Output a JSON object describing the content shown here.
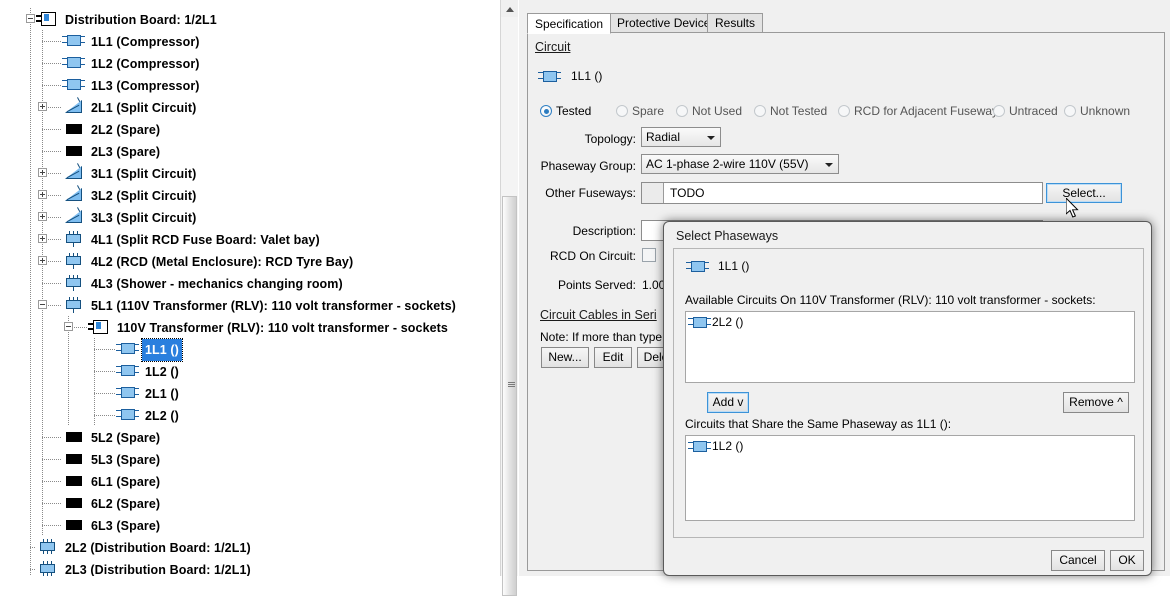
{
  "tree": {
    "name": "circuit-tree",
    "rows": [
      {
        "label": "Distribution Board: 1/2L1",
        "icon": "board-icon",
        "depth": 0,
        "expander": "minus",
        "selected": false
      },
      {
        "label": "1L1 (Compressor)",
        "icon": "circuit-icon",
        "depth": 1,
        "expander": "none",
        "selected": false
      },
      {
        "label": "1L2 (Compressor)",
        "icon": "circuit-icon",
        "depth": 1,
        "expander": "none",
        "selected": false
      },
      {
        "label": "1L3 (Compressor)",
        "icon": "circuit-icon",
        "depth": 1,
        "expander": "none",
        "selected": false
      },
      {
        "label": "2L1 (Split Circuit)",
        "icon": "split-circuit-icon",
        "depth": 1,
        "expander": "plus",
        "selected": false
      },
      {
        "label": "2L2 (Spare)",
        "icon": "spare-icon",
        "depth": 1,
        "expander": "none",
        "selected": false
      },
      {
        "label": "2L3 (Spare)",
        "icon": "spare-icon",
        "depth": 1,
        "expander": "none",
        "selected": false
      },
      {
        "label": "3L1 (Split Circuit)",
        "icon": "split-circuit-icon",
        "depth": 1,
        "expander": "plus",
        "selected": false
      },
      {
        "label": "3L2 (Split Circuit)",
        "icon": "split-circuit-icon",
        "depth": 1,
        "expander": "plus",
        "selected": false
      },
      {
        "label": "3L3 (Split Circuit)",
        "icon": "split-circuit-icon",
        "depth": 1,
        "expander": "plus",
        "selected": false
      },
      {
        "label": "4L1 (Split RCD Fuse Board: Valet bay)",
        "icon": "rcd-icon",
        "depth": 1,
        "expander": "plus",
        "selected": false
      },
      {
        "label": "4L2 (RCD (Metal Enclosure): RCD Tyre Bay)",
        "icon": "rcd-icon",
        "depth": 1,
        "expander": "plus",
        "selected": false
      },
      {
        "label": "4L3 (Shower - mechanics changing room)",
        "icon": "rcd-icon",
        "depth": 1,
        "expander": "none",
        "selected": false
      },
      {
        "label": "5L1 (110V Transformer (RLV): 110 volt transformer - sockets)",
        "icon": "rcd-icon",
        "depth": 1,
        "expander": "minus",
        "selected": false
      },
      {
        "label": "110V Transformer (RLV): 110 volt transformer - sockets",
        "icon": "board-icon",
        "depth": 2,
        "expander": "minus",
        "selected": false
      },
      {
        "label": "1L1 ()",
        "icon": "circuit-icon",
        "depth": 3,
        "expander": "none",
        "selected": true
      },
      {
        "label": "1L2 ()",
        "icon": "circuit-icon",
        "depth": 3,
        "expander": "none",
        "selected": false
      },
      {
        "label": "2L1 ()",
        "icon": "circuit-icon",
        "depth": 3,
        "expander": "none",
        "selected": false
      },
      {
        "label": "2L2 ()",
        "icon": "circuit-icon",
        "depth": 3,
        "expander": "none",
        "selected": false
      },
      {
        "label": "5L2 (Spare)",
        "icon": "spare-icon",
        "depth": 1,
        "expander": "none",
        "selected": false
      },
      {
        "label": "5L3 (Spare)",
        "icon": "spare-icon",
        "depth": 1,
        "expander": "none",
        "selected": false
      },
      {
        "label": "6L1 (Spare)",
        "icon": "spare-icon",
        "depth": 1,
        "expander": "none",
        "selected": false
      },
      {
        "label": "6L2 (Spare)",
        "icon": "spare-icon",
        "depth": 1,
        "expander": "none",
        "selected": false
      },
      {
        "label": "6L3 (Spare)",
        "icon": "spare-icon",
        "depth": 1,
        "expander": "none",
        "selected": false
      },
      {
        "label": "2L2 (Distribution Board: 1/2L1)",
        "icon": "db-icon",
        "depth": 0,
        "expander": "none",
        "selected": false
      },
      {
        "label": "2L3 (Distribution Board: 1/2L1)",
        "icon": "db-icon",
        "depth": 0,
        "expander": "none",
        "selected": false
      }
    ]
  },
  "tabs": [
    {
      "label": "Specification",
      "active": true
    },
    {
      "label": "Protective Device",
      "active": false
    },
    {
      "label": "Results",
      "active": false
    }
  ],
  "spec": {
    "section_title": "Circuit",
    "circuit_name": "1L1 ()",
    "status_options": [
      {
        "label": "Tested",
        "selected": true
      },
      {
        "label": "Spare",
        "selected": false
      },
      {
        "label": "Not Used",
        "selected": false
      },
      {
        "label": "Not Tested",
        "selected": false
      },
      {
        "label": "RCD for Adjacent Fuseway",
        "selected": false
      },
      {
        "label": "Untraced",
        "selected": false
      },
      {
        "label": "Unknown",
        "selected": false
      }
    ],
    "topology_label": "Topology:",
    "topology_value": "Radial",
    "phaseway_group_label": "Phaseway Group:",
    "phaseway_group_value": "AC 1-phase 2-wire 110V (55V)",
    "other_fuseways_label": "Other Fuseways:",
    "other_fuseways_value": "TODO",
    "select_button": "Select...",
    "description_label": "Description:",
    "rcd_on_circuit_label": "RCD On Circuit:",
    "points_served_label": "Points Served:",
    "points_served_value": "1.00",
    "cables_section_title": "Circuit Cables in Seri",
    "cables_note": "Note: If more than type of",
    "cables_new_button": "New...",
    "cables_edit_button": "Edit",
    "cables_delete_button": "Dele"
  },
  "dialog": {
    "title": "Select Phaseways",
    "circuit_name": "1L1 ()",
    "available_label": "Available Circuits On 110V Transformer (RLV): 110 volt transformer - sockets:",
    "available_items": [
      "2L2 ()"
    ],
    "add_button": "Add v",
    "remove_button": "Remove ^",
    "shared_label": "Circuits that Share the Same Phaseway as 1L1 ():",
    "shared_items": [
      "1L2 ()"
    ],
    "cancel_button": "Cancel",
    "ok_button": "OK"
  },
  "colors": {
    "selection": "#2a7fde",
    "icon_blue": "#8fc6f0",
    "icon_blue_border": "#15507f",
    "focus_border": "#3c93d8"
  }
}
